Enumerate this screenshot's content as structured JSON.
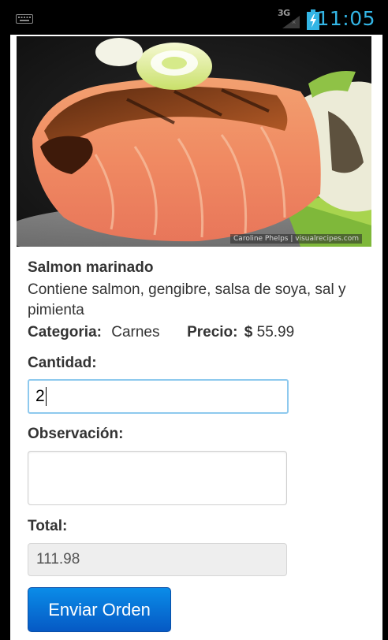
{
  "status_bar": {
    "network_label": "3G",
    "network_badge": "×",
    "clock": "11:05",
    "accent_color": "#33b5e5"
  },
  "hero": {
    "credit": "Caroline Phelps | visualrecipes.com"
  },
  "dish": {
    "name": "Salmon marinado",
    "description": "Contiene salmon, gengibre, salsa de soya, sal y pimienta",
    "category_label": "Categoria:",
    "category_value": "Carnes",
    "price_label": "Precio:",
    "price_currency": "$",
    "price_value": "55.99"
  },
  "form": {
    "quantity_label": "Cantidad:",
    "quantity_value": "2",
    "observation_label": "Observación:",
    "observation_value": "",
    "total_label": "Total:",
    "total_value": "111.98",
    "submit_label": "Enviar Orden",
    "submit_color": "#0a78dc"
  }
}
